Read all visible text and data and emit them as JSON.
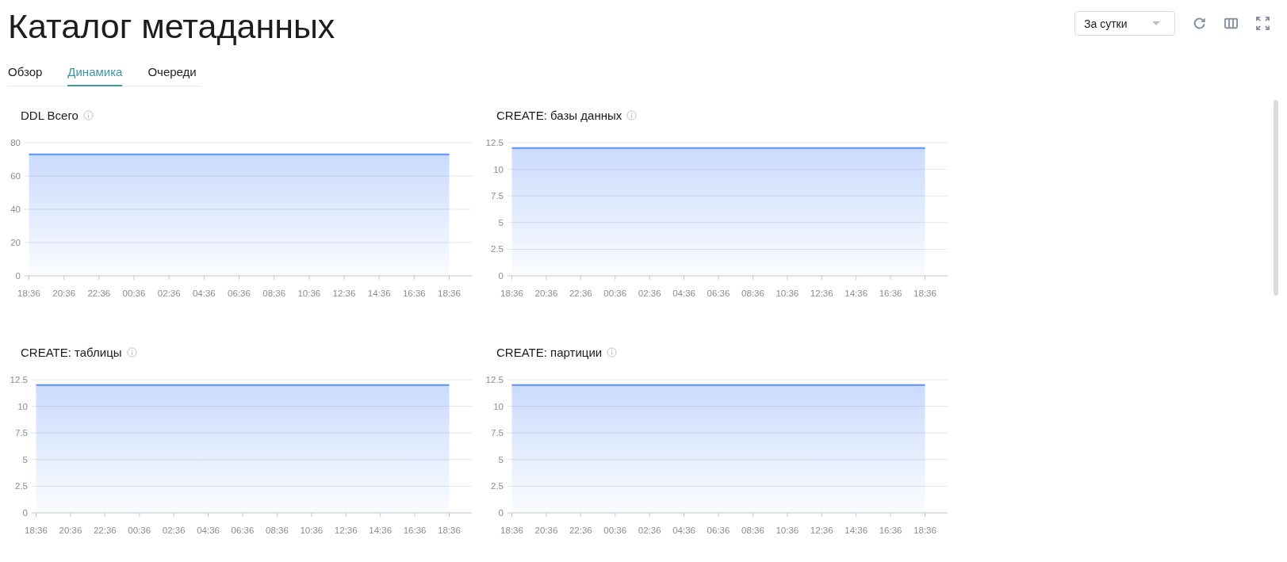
{
  "header": {
    "title": "Каталог метаданных",
    "period_select": {
      "value": "За сутки"
    }
  },
  "tabs": [
    {
      "label": "Обзор",
      "selected": false
    },
    {
      "label": "Динамика",
      "selected": true
    },
    {
      "label": "Очереди",
      "selected": false
    }
  ],
  "charts": [
    {
      "chart_data": {
        "type": "area",
        "title": "DDL Всего",
        "categories": [
          "18:36",
          "20:36",
          "22:36",
          "00:36",
          "02:36",
          "04:36",
          "06:36",
          "08:36",
          "10:36",
          "12:36",
          "14:36",
          "16:36",
          "18:36"
        ],
        "series": [
          {
            "color": "#5b8ff9",
            "values": [
              73,
              73,
              73,
              73,
              73,
              73,
              73,
              73,
              73,
              73,
              73,
              73,
              73
            ]
          }
        ],
        "ylim": [
          0,
          80
        ],
        "yticks": [
          0,
          20,
          40,
          60,
          80
        ],
        "grid": true
      }
    },
    {
      "chart_data": {
        "type": "area",
        "title": "CREATE: базы данных",
        "categories": [
          "18:36",
          "20:36",
          "22:36",
          "00:36",
          "02:36",
          "04:36",
          "06:36",
          "08:36",
          "10:36",
          "12:36",
          "14:36",
          "16:36",
          "18:36"
        ],
        "series": [
          {
            "color": "#5b8ff9",
            "values": [
              12,
              12,
              12,
              12,
              12,
              12,
              12,
              12,
              12,
              12,
              12,
              12,
              12
            ]
          }
        ],
        "ylim": [
          0,
          12.5
        ],
        "yticks": [
          0,
          2.5,
          5,
          7.5,
          10,
          12.5
        ],
        "grid": true
      }
    },
    {
      "chart_data": {
        "type": "area",
        "title": "CREATE: таблицы",
        "categories": [
          "18:36",
          "20:36",
          "22:36",
          "00:36",
          "02:36",
          "04:36",
          "06:36",
          "08:36",
          "10:36",
          "12:36",
          "14:36",
          "16:36",
          "18:36"
        ],
        "series": [
          {
            "color": "#5b8ff9",
            "values": [
              12,
              12,
              12,
              12,
              12,
              12,
              12,
              12,
              12,
              12,
              12,
              12,
              12
            ]
          }
        ],
        "ylim": [
          0,
          12.5
        ],
        "yticks": [
          0,
          2.5,
          5,
          7.5,
          10,
          12.5
        ],
        "grid": true
      }
    },
    {
      "chart_data": {
        "type": "area",
        "title": "CREATE: партиции",
        "categories": [
          "18:36",
          "20:36",
          "22:36",
          "00:36",
          "02:36",
          "04:36",
          "06:36",
          "08:36",
          "10:36",
          "12:36",
          "14:36",
          "16:36",
          "18:36"
        ],
        "series": [
          {
            "color": "#5b8ff9",
            "values": [
              12,
              12,
              12,
              12,
              12,
              12,
              12,
              12,
              12,
              12,
              12,
              12,
              12
            ]
          }
        ],
        "ylim": [
          0,
          12.5
        ],
        "yticks": [
          0,
          2.5,
          5,
          7.5,
          10,
          12.5
        ],
        "grid": true
      }
    }
  ]
}
